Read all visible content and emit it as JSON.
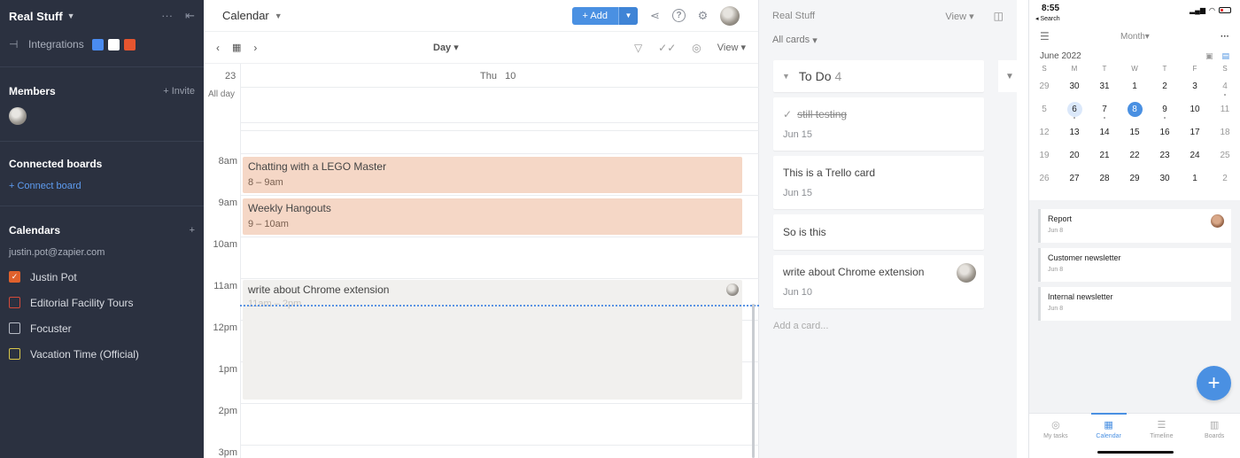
{
  "sidebar": {
    "workspace": "Real Stuff",
    "integrations_label": "Integrations",
    "members_title": "Members",
    "invite_label": "+ Invite",
    "connected_title": "Connected boards",
    "connect_board_label": "+ Connect board",
    "calendars_title": "Calendars",
    "add_calendar": "+",
    "account_email": "justin.pot@zapier.com",
    "calendars": [
      {
        "label": "Justin Pot",
        "checked": true,
        "color": "#e0612c"
      },
      {
        "label": "Editorial Facility Tours",
        "checked": false,
        "color": "#d44a3a"
      },
      {
        "label": "Focuster",
        "checked": false,
        "color": "#b8bcc6"
      },
      {
        "label": "Vacation Time (Official)",
        "checked": false,
        "color": "#d8c64a"
      }
    ]
  },
  "calendar": {
    "title": "Calendar",
    "add_label": "+ Add",
    "view_mode": "Day",
    "view_label": "View",
    "week_number": "23",
    "day_header": "Thu   10",
    "all_day_label": "All day",
    "hours": [
      "8am",
      "9am",
      "10am",
      "11am",
      "12pm",
      "1pm",
      "2pm",
      "3pm"
    ],
    "events": [
      {
        "title": "Chatting with a LEGO Master",
        "time": "8 – 9am"
      },
      {
        "title": "Weekly Hangouts",
        "time": "9 – 10am"
      },
      {
        "title": "write about Chrome extension",
        "time": "11am – 2pm"
      }
    ]
  },
  "board": {
    "title": "Real Stuff",
    "view_label": "View",
    "filter_label": "All cards",
    "column_title": "To Do",
    "column_count": "4",
    "cards": [
      {
        "title": "still testing",
        "date": "Jun 15",
        "done": true
      },
      {
        "title": "This is a Trello card",
        "date": "Jun 15"
      },
      {
        "title": "So is this",
        "date": ""
      },
      {
        "title": "write about Chrome extension",
        "date": "Jun 10"
      }
    ],
    "add_card": "Add a card..."
  },
  "phone": {
    "time": "8:55",
    "back": "◂ Search",
    "view_mode": "Month",
    "month_label": "June 2022",
    "weekdays": [
      "S",
      "M",
      "T",
      "W",
      "T",
      "F",
      "S"
    ],
    "weeks": [
      [
        "29",
        "30",
        "31",
        "1",
        "2",
        "3",
        "4"
      ],
      [
        "5",
        "6",
        "7",
        "8",
        "9",
        "10",
        "11"
      ],
      [
        "12",
        "13",
        "14",
        "15",
        "16",
        "17",
        "18"
      ],
      [
        "19",
        "20",
        "21",
        "22",
        "23",
        "24",
        "25"
      ],
      [
        "26",
        "27",
        "28",
        "29",
        "30",
        "1",
        "2"
      ]
    ],
    "tasks": [
      {
        "name": "Report",
        "date": "Jun 8"
      },
      {
        "name": "Customer newsletter",
        "date": "Jun 8"
      },
      {
        "name": "Internal newsletter",
        "date": "Jun 8"
      }
    ],
    "tabs": [
      "My tasks",
      "Calendar",
      "Timeline",
      "Boards"
    ],
    "accent": "#4a90e2"
  }
}
